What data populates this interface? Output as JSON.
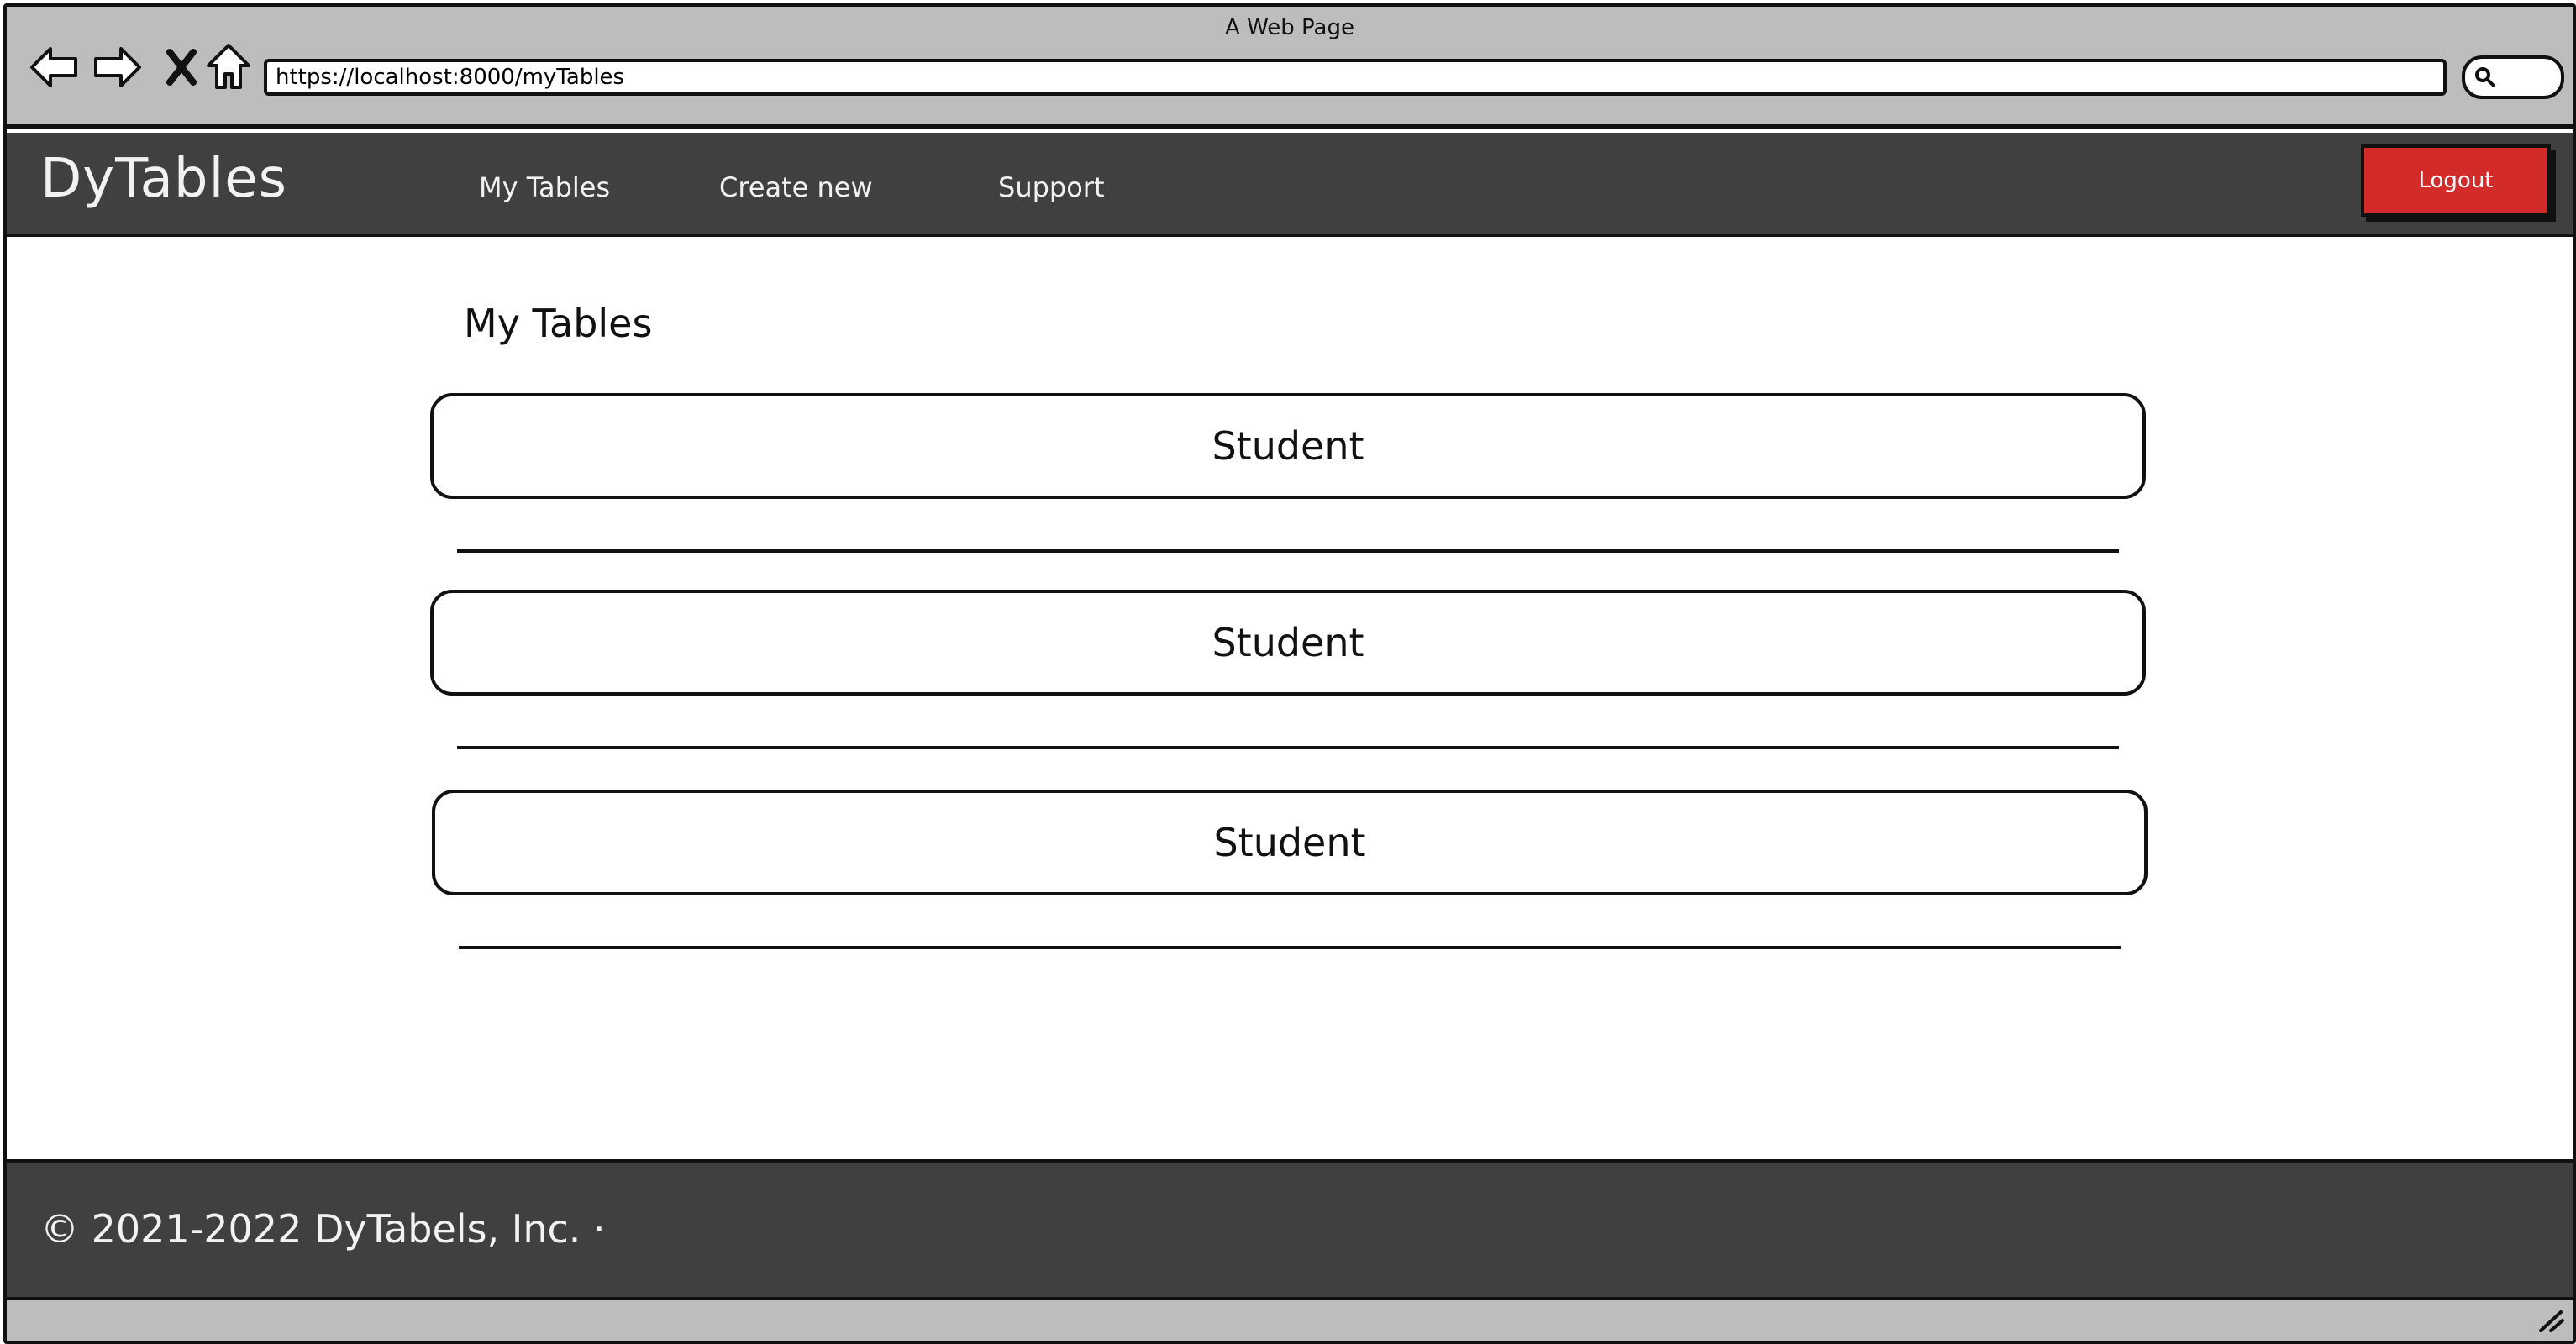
{
  "window": {
    "title": "A Web Page"
  },
  "address_bar": {
    "url": "https://localhost:8000/myTables"
  },
  "chrome_icons": [
    "back-arrow-icon",
    "forward-arrow-icon",
    "stop-x-icon",
    "home-icon",
    "search-icon"
  ],
  "header": {
    "brand": "DyTables",
    "nav": [
      {
        "label": "My Tables"
      },
      {
        "label": "Create new"
      },
      {
        "label": "Support"
      }
    ],
    "logout_label": "Logout"
  },
  "main": {
    "title": "My Tables",
    "tables": [
      {
        "name": "Student"
      },
      {
        "name": "Student"
      },
      {
        "name": "Student"
      }
    ]
  },
  "footer": {
    "copyright": "© 2021-2022 DyTabels, Inc. ·"
  },
  "colors": {
    "chrome": "#bdbdbd",
    "header_bg": "#404040",
    "logout_bg": "#d32a2a",
    "text_light": "#f2f2f2"
  }
}
